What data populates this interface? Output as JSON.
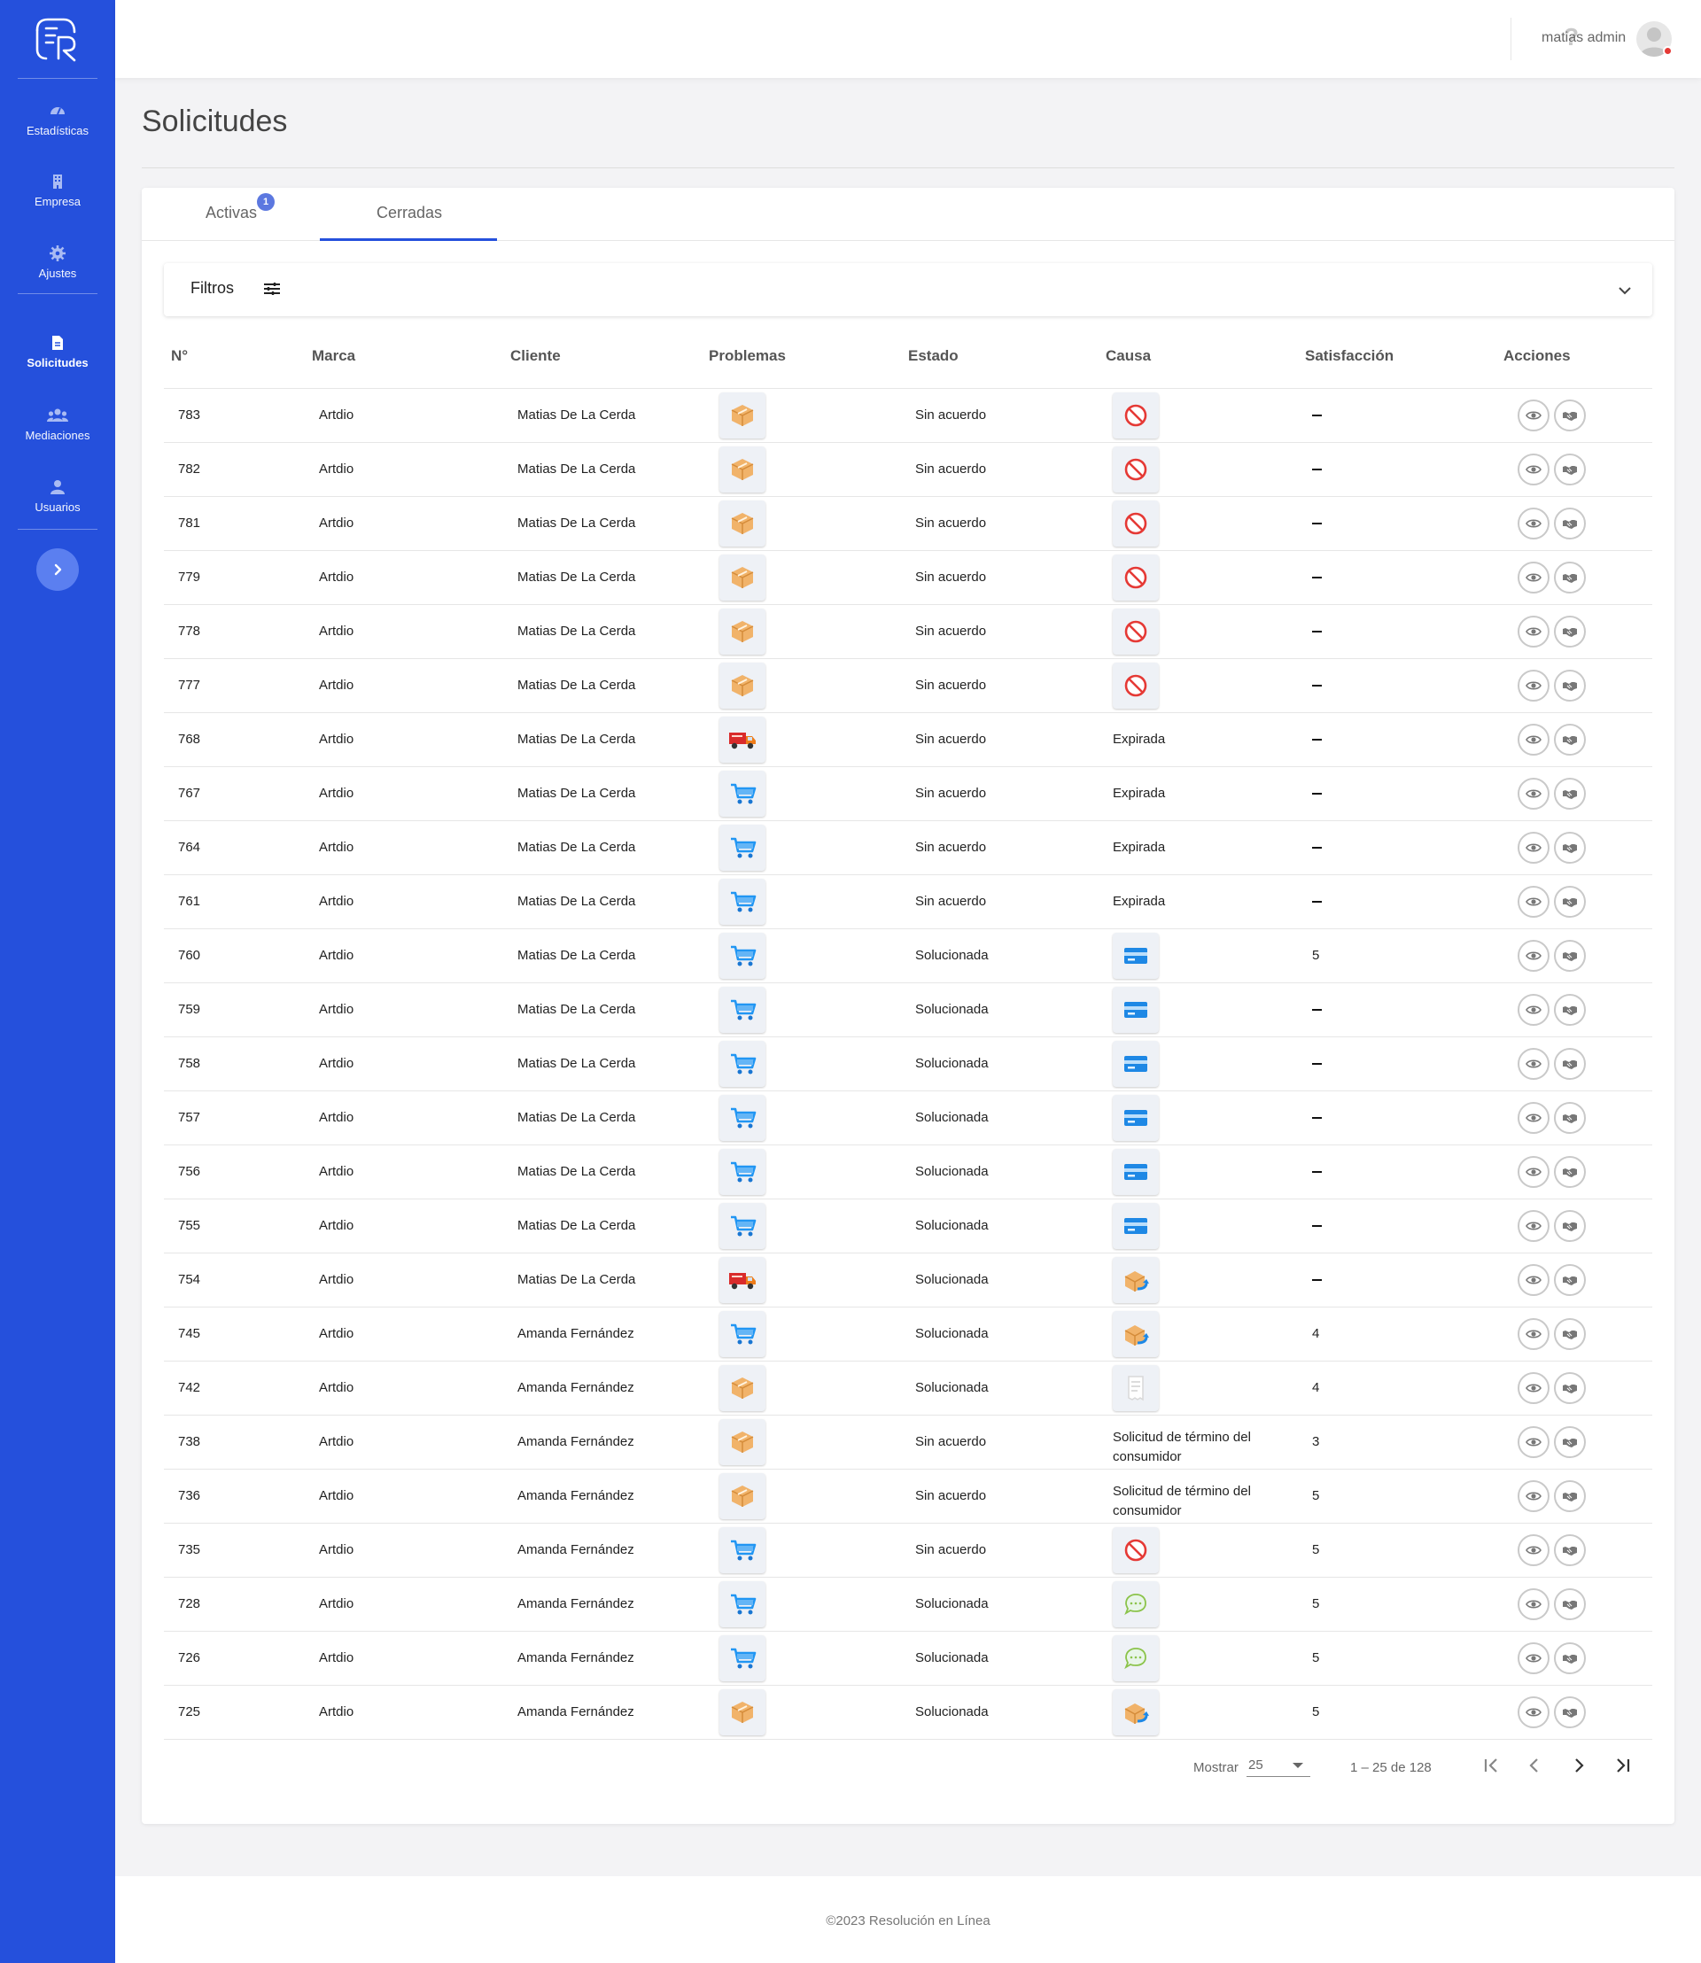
{
  "app": {
    "user_name": "matias admin",
    "help_label": "?"
  },
  "sidebar": {
    "items": [
      {
        "label": "Estadísticas",
        "icon": "dashboard-icon"
      },
      {
        "label": "Empresa",
        "icon": "building-icon"
      },
      {
        "label": "Ajustes",
        "icon": "gear-icon"
      },
      {
        "label": "Solicitudes",
        "icon": "document-icon",
        "active": true
      },
      {
        "label": "Mediaciones",
        "icon": "group-icon"
      },
      {
        "label": "Usuarios",
        "icon": "user-icon"
      }
    ]
  },
  "page": {
    "title": "Solicitudes"
  },
  "tabs": [
    {
      "label": "Activas",
      "badge": "1"
    },
    {
      "label": "Cerradas",
      "active": true
    }
  ],
  "filters": {
    "label": "Filtros"
  },
  "table": {
    "columns": [
      "N°",
      "Marca",
      "Cliente",
      "Problemas",
      "Estado",
      "Causa",
      "Satisfacción",
      "Acciones"
    ],
    "rows": [
      {
        "id": "783",
        "marca": "Artdio",
        "cliente": "Matias De La Cerda",
        "problema": "box-icon",
        "estado": "Sin acuerdo",
        "causa_icon": "no-entry-icon",
        "causa_text": "",
        "satisfaccion": ""
      },
      {
        "id": "782",
        "marca": "Artdio",
        "cliente": "Matias De La Cerda",
        "problema": "box-icon",
        "estado": "Sin acuerdo",
        "causa_icon": "no-entry-icon",
        "causa_text": "",
        "satisfaccion": ""
      },
      {
        "id": "781",
        "marca": "Artdio",
        "cliente": "Matias De La Cerda",
        "problema": "box-icon",
        "estado": "Sin acuerdo",
        "causa_icon": "no-entry-icon",
        "causa_text": "",
        "satisfaccion": ""
      },
      {
        "id": "779",
        "marca": "Artdio",
        "cliente": "Matias De La Cerda",
        "problema": "box-icon",
        "estado": "Sin acuerdo",
        "causa_icon": "no-entry-icon",
        "causa_text": "",
        "satisfaccion": ""
      },
      {
        "id": "778",
        "marca": "Artdio",
        "cliente": "Matias De La Cerda",
        "problema": "box-icon",
        "estado": "Sin acuerdo",
        "causa_icon": "no-entry-icon",
        "causa_text": "",
        "satisfaccion": ""
      },
      {
        "id": "777",
        "marca": "Artdio",
        "cliente": "Matias De La Cerda",
        "problema": "box-icon",
        "estado": "Sin acuerdo",
        "causa_icon": "no-entry-icon",
        "causa_text": "",
        "satisfaccion": ""
      },
      {
        "id": "768",
        "marca": "Artdio",
        "cliente": "Matias De La Cerda",
        "problema": "truck-icon",
        "estado": "Sin acuerdo",
        "causa_icon": "",
        "causa_text": "Expirada",
        "satisfaccion": ""
      },
      {
        "id": "767",
        "marca": "Artdio",
        "cliente": "Matias De La Cerda",
        "problema": "cart-icon",
        "estado": "Sin acuerdo",
        "causa_icon": "",
        "causa_text": "Expirada",
        "satisfaccion": ""
      },
      {
        "id": "764",
        "marca": "Artdio",
        "cliente": "Matias De La Cerda",
        "problema": "cart-icon",
        "estado": "Sin acuerdo",
        "causa_icon": "",
        "causa_text": "Expirada",
        "satisfaccion": ""
      },
      {
        "id": "761",
        "marca": "Artdio",
        "cliente": "Matias De La Cerda",
        "problema": "cart-icon",
        "estado": "Sin acuerdo",
        "causa_icon": "",
        "causa_text": "Expirada",
        "satisfaccion": ""
      },
      {
        "id": "760",
        "marca": "Artdio",
        "cliente": "Matias De La Cerda",
        "problema": "cart-icon",
        "estado": "Solucionada",
        "causa_icon": "card-icon",
        "causa_text": "",
        "satisfaccion": "5"
      },
      {
        "id": "759",
        "marca": "Artdio",
        "cliente": "Matias De La Cerda",
        "problema": "cart-icon",
        "estado": "Solucionada",
        "causa_icon": "card-icon",
        "causa_text": "",
        "satisfaccion": ""
      },
      {
        "id": "758",
        "marca": "Artdio",
        "cliente": "Matias De La Cerda",
        "problema": "cart-icon",
        "estado": "Solucionada",
        "causa_icon": "card-icon",
        "causa_text": "",
        "satisfaccion": ""
      },
      {
        "id": "757",
        "marca": "Artdio",
        "cliente": "Matias De La Cerda",
        "problema": "cart-icon",
        "estado": "Solucionada",
        "causa_icon": "card-icon",
        "causa_text": "",
        "satisfaccion": ""
      },
      {
        "id": "756",
        "marca": "Artdio",
        "cliente": "Matias De La Cerda",
        "problema": "cart-icon",
        "estado": "Solucionada",
        "causa_icon": "card-icon",
        "causa_text": "",
        "satisfaccion": ""
      },
      {
        "id": "755",
        "marca": "Artdio",
        "cliente": "Matias De La Cerda",
        "problema": "cart-icon",
        "estado": "Solucionada",
        "causa_icon": "card-icon",
        "causa_text": "",
        "satisfaccion": ""
      },
      {
        "id": "754",
        "marca": "Artdio",
        "cliente": "Matias De La Cerda",
        "problema": "truck-icon",
        "estado": "Solucionada",
        "causa_icon": "box-return-icon",
        "causa_text": "",
        "satisfaccion": ""
      },
      {
        "id": "745",
        "marca": "Artdio",
        "cliente": "Amanda Fernández",
        "problema": "cart-icon",
        "estado": "Solucionada",
        "causa_icon": "box-return-icon",
        "causa_text": "",
        "satisfaccion": "4"
      },
      {
        "id": "742",
        "marca": "Artdio",
        "cliente": "Amanda Fernández",
        "problema": "box-icon",
        "estado": "Solucionada",
        "causa_icon": "receipt-icon",
        "causa_text": "",
        "satisfaccion": "4"
      },
      {
        "id": "738",
        "marca": "Artdio",
        "cliente": "Amanda Fernández",
        "problema": "box-icon",
        "estado": "Sin acuerdo",
        "causa_icon": "",
        "causa_text": "Solicitud de término del consumidor",
        "satisfaccion": "3"
      },
      {
        "id": "736",
        "marca": "Artdio",
        "cliente": "Amanda Fernández",
        "problema": "box-icon",
        "estado": "Sin acuerdo",
        "causa_icon": "",
        "causa_text": "Solicitud de término del consumidor",
        "satisfaccion": "5"
      },
      {
        "id": "735",
        "marca": "Artdio",
        "cliente": "Amanda Fernández",
        "problema": "cart-icon",
        "estado": "Sin acuerdo",
        "causa_icon": "no-entry-icon",
        "causa_text": "",
        "satisfaccion": "5"
      },
      {
        "id": "728",
        "marca": "Artdio",
        "cliente": "Amanda Fernández",
        "problema": "cart-icon",
        "estado": "Solucionada",
        "causa_icon": "chat-icon",
        "causa_text": "",
        "satisfaccion": "5"
      },
      {
        "id": "726",
        "marca": "Artdio",
        "cliente": "Amanda Fernández",
        "problema": "cart-icon",
        "estado": "Solucionada",
        "causa_icon": "chat-icon",
        "causa_text": "",
        "satisfaccion": "5"
      },
      {
        "id": "725",
        "marca": "Artdio",
        "cliente": "Amanda Fernández",
        "problema": "box-icon",
        "estado": "Solucionada",
        "causa_icon": "box-return-icon",
        "causa_text": "",
        "satisfaccion": "5"
      }
    ]
  },
  "pagination": {
    "show_label": "Mostrar",
    "page_size": "25",
    "range": "1 – 25 de 128"
  },
  "footer": {
    "text": "©2023 Resolución en Línea"
  },
  "colors": {
    "sidebar": "#2550dc",
    "accent": "#2550dc",
    "badge": "#5c78e0"
  }
}
